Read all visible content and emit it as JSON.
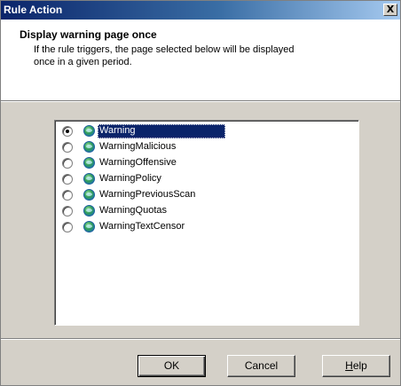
{
  "window": {
    "title": "Rule Action",
    "close_label": "X"
  },
  "header": {
    "title": "Display warning page once",
    "description": "If the rule triggers, the page selected below will be displayed once in a given period."
  },
  "pages": {
    "items": [
      {
        "label": "Warning",
        "selected": true,
        "icon": "globe-page-icon"
      },
      {
        "label": "WarningMalicious",
        "selected": false,
        "icon": "globe-page-icon"
      },
      {
        "label": "WarningOffensive",
        "selected": false,
        "icon": "globe-page-icon"
      },
      {
        "label": "WarningPolicy",
        "selected": false,
        "icon": "globe-page-icon"
      },
      {
        "label": "WarningPreviousScan",
        "selected": false,
        "icon": "globe-page-icon"
      },
      {
        "label": "WarningQuotas",
        "selected": false,
        "icon": "globe-page-icon"
      },
      {
        "label": "WarningTextCensor",
        "selected": false,
        "icon": "globe-page-icon"
      }
    ]
  },
  "buttons": {
    "ok": "OK",
    "cancel": "Cancel",
    "help_accel": "H",
    "help_rest": "elp"
  }
}
